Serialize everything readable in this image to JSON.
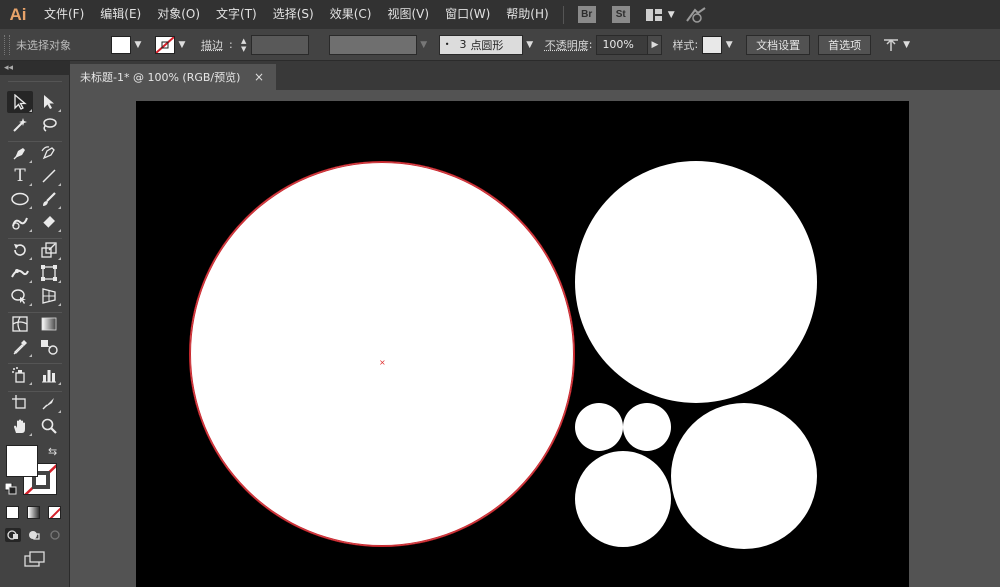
{
  "app": {
    "logo": "Ai",
    "menus": [
      "文件(F)",
      "编辑(E)",
      "对象(O)",
      "文字(T)",
      "选择(S)",
      "效果(C)",
      "视图(V)",
      "窗口(W)",
      "帮助(H)"
    ],
    "bridge": "Br",
    "stock": "St"
  },
  "control": {
    "selection": "未选择对象",
    "stroke_label": "描边",
    "brush_size": "3",
    "brush_name": "点圆形",
    "opacity_label": "不透明度",
    "opacity_value": "100%",
    "style_label": "样式",
    "doc_setup": "文档设置",
    "preferences": "首选项",
    "colors": {
      "fill": "#ffffff",
      "stroke_none": "#ffffff",
      "swatch_style": "#e8e8e8"
    }
  },
  "document": {
    "tab_title": "未标题-1* @ 100% (RGB/预览)",
    "close": "×"
  },
  "toolbar": {
    "collapse": "◂◂",
    "fill_color": "#ffffff",
    "stroke_color": "none"
  },
  "canvas": {
    "artboard_color": "#000000",
    "shape_fill": "#ffffff",
    "selection_color": "#c8282e",
    "circles": 6
  }
}
